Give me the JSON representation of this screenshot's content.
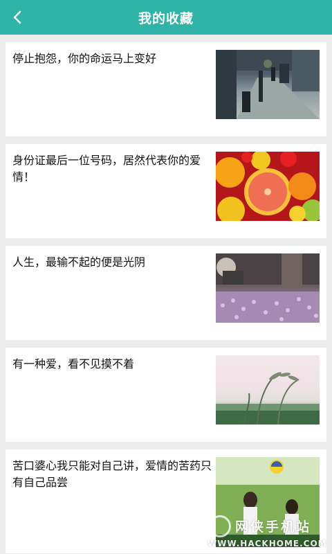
{
  "header": {
    "back_icon": "chevron-left-icon",
    "title": "我的收藏",
    "bar_color": "#2fb3a6"
  },
  "favorites": [
    {
      "title": "停止抱怨，你的命运马上变好",
      "thumbnail": "street-scene"
    },
    {
      "title": "身份证最后一位号码，居然代表你的爱情！",
      "thumbnail": "citrus-fruits"
    },
    {
      "title": "人生，最输不起的便是光阴",
      "thumbnail": "purple-flower-field"
    },
    {
      "title": "有一种爱，看不见摸不着",
      "thumbnail": "grass-stems"
    },
    {
      "title": "苦口婆心我只能对自己讲，爱情的苦药只有自己品尝",
      "thumbnail": "girls-volleyball"
    }
  ],
  "watermark": {
    "text": "网侠手机站",
    "url": "WWW.HACKHOME.COM"
  }
}
